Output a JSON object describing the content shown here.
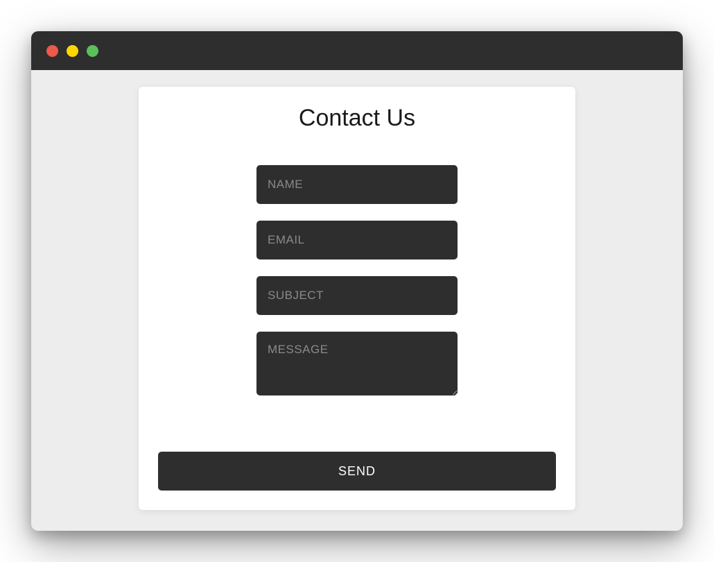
{
  "form": {
    "title": "Contact Us",
    "fields": {
      "name": {
        "placeholder": "NAME",
        "value": ""
      },
      "email": {
        "placeholder": "EMAIL",
        "value": ""
      },
      "subject": {
        "placeholder": "SUBJECT",
        "value": ""
      },
      "message": {
        "placeholder": "MESSAGE",
        "value": ""
      }
    },
    "submit_label": "SEND"
  },
  "colors": {
    "window_bg": "#ededed",
    "titlebar_bg": "#2e2e2e",
    "card_bg": "#ffffff",
    "input_bg": "#2e2e2e",
    "placeholder": "#8a8a8a",
    "traffic_red": "#ed594a",
    "traffic_yellow": "#fdd800",
    "traffic_green": "#5ac05a"
  }
}
